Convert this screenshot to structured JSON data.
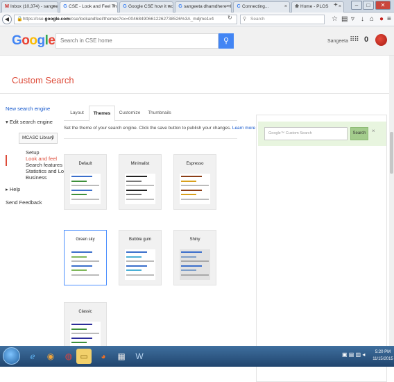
{
  "browser": {
    "tabs": [
      {
        "label": "Inbox (10,374) - sangeet...",
        "favicon": "M",
        "color": "#c5221f"
      },
      {
        "label": "CSE - Look and Feel The...",
        "favicon": "G",
        "color": "#4285f4"
      },
      {
        "label": "Google CSE how it work...",
        "favicon": "G",
        "color": "#4285f4"
      },
      {
        "label": "sangeeta dhamdhere +b...",
        "favicon": "G",
        "color": "#4285f4"
      },
      {
        "label": "Connecting...",
        "favicon": "C",
        "color": "#4285f4"
      },
      {
        "label": "Home - PLOS",
        "favicon": "❀",
        "color": "#555555"
      }
    ],
    "new_tab_label": "+",
    "url_prefix": "https://cse.",
    "url_domain": "google.com",
    "url_rest": "/cse/lookandfeel/themes?cx=004684906612262738526%3A_mdjmo1v4",
    "search_placeholder": "Search"
  },
  "header": {
    "logo_letters": [
      "G",
      "o",
      "o",
      "g",
      "l",
      "e"
    ],
    "logo_colors": [
      "#4285f4",
      "#ea4335",
      "#fbbc05",
      "#4285f4",
      "#34a853",
      "#ea4335"
    ],
    "search_placeholder": "Search in CSE home",
    "username": "Sangeeta",
    "notif_count": "0"
  },
  "page_title": "Custom Search",
  "sidebar": {
    "new_engine": "New search engine",
    "edit_engine": "Edit search engine",
    "engine_select": "MCASC Library",
    "items": [
      "Setup",
      "Look and feel",
      "Search features",
      "Statistics and Logs",
      "Business"
    ],
    "help": "Help",
    "feedback": "Send Feedback"
  },
  "content_tabs": [
    "Layout",
    "Themes",
    "Customize",
    "Thumbnails"
  ],
  "instructions": {
    "text": "Set the theme of your search engine. Click the save button to publish your changes.",
    "link": "Learn more"
  },
  "themes": [
    {
      "name": "Default",
      "colors": [
        "#3a6ecb",
        "#3d8f3a",
        "#bbbbbb",
        "#3a6ecb",
        "#3d8f3a",
        "#bbbbbb"
      ],
      "bg": "#ffffff"
    },
    {
      "name": "Minimalist",
      "colors": [
        "#222222",
        "#777777",
        "#bbbbbb",
        "#222222",
        "#777777",
        "#bbbbbb"
      ],
      "bg": "#ffffff"
    },
    {
      "name": "Espresso",
      "colors": [
        "#8a3d16",
        "#d9a01c",
        "#bbbbbb",
        "#8a3d16",
        "#d9a01c",
        "#bbbbbb"
      ],
      "bg": "#ffffff"
    },
    {
      "name": "Green sky",
      "colors": [
        "#3a6ecb",
        "#7fb85a",
        "#bbbbbb",
        "#3a6ecb",
        "#7fb85a",
        "#bbbbbb"
      ],
      "bg": "#ffffff"
    },
    {
      "name": "Bubble gum",
      "colors": [
        "#3a6ecb",
        "#4bb0d6",
        "#bbbbbb",
        "#3a6ecb",
        "#4bb0d6",
        "#bbbbbb"
      ],
      "bg": "#ffffff"
    },
    {
      "name": "Shiny",
      "colors": [
        "#3a6ecb",
        "#7d9ec8",
        "#a9a9a9",
        "#3a6ecb",
        "#7d9ec8",
        "#a9a9a9"
      ],
      "bg": "#e2e2e2"
    },
    {
      "name": "Classic",
      "colors": [
        "#2c2c99",
        "#3d8f3a",
        "#bbbbbb",
        "#2c2c99",
        "#3d8f3a",
        "#bbbbbb"
      ],
      "bg": "#ffffff"
    }
  ],
  "selected_theme": "Green sky",
  "preview": {
    "input_placeholder": "Google™ Custom Search",
    "button_label": "Search",
    "clear_label": "×"
  },
  "taskbar": {
    "time": "5:20 PM",
    "date": "11/15/2015"
  }
}
